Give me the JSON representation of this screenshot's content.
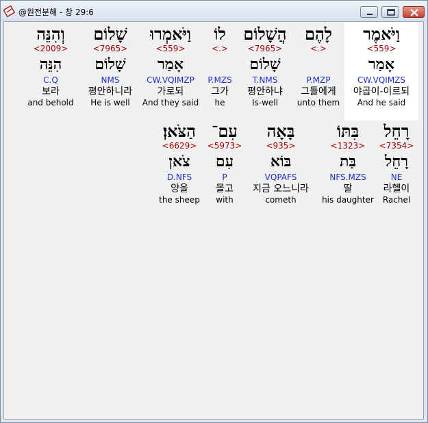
{
  "window": {
    "title": "@원전분해 - 창 29:6",
    "minimize_icon": "minimize-icon",
    "maximize_icon": "maximize-icon",
    "close_icon": "close-icon",
    "app_icon": "bible-app-icon"
  },
  "rows": [
    {
      "words": [
        {
          "hebrew": "וַיֹּאמֶר",
          "strong": "<559>",
          "root": "אָמַר",
          "parse": "CW.VQIMZS",
          "korean": "야곱이-이르되",
          "english": "And he said",
          "selected": true
        },
        {
          "hebrew": "לָהֶם",
          "strong": "<.>",
          "root": "",
          "parse": "P.MZP",
          "korean": "그들에게",
          "english": "unto them"
        },
        {
          "hebrew": "הֲשָׁלוֹם",
          "strong": "<7965>",
          "root": "שָׁלוֹם",
          "parse": "T.NMS",
          "korean": "평안하냐",
          "english": "Is-well"
        },
        {
          "hebrew": "לוֹ",
          "strong": "<.>",
          "root": "",
          "parse": "P.MZS",
          "korean": "그가",
          "english": "he"
        },
        {
          "hebrew": "וַיֹּאמְרוּ",
          "strong": "<559>",
          "root": "אָמַר",
          "parse": "CW.VQIMZP",
          "korean": "가로되",
          "english": "And they said"
        },
        {
          "hebrew": "שָׁלוֹם",
          "strong": "<7965>",
          "root": "שָׁלוֹם",
          "parse": "NMS",
          "korean": "평안하니라",
          "english": "He is well"
        },
        {
          "hebrew": "וְהִנֵּה",
          "strong": "<2009>",
          "root": "הִנֵּה",
          "parse": "C.Q",
          "korean": "보라",
          "english": "and behold"
        }
      ]
    },
    {
      "words": [
        {
          "hebrew": "רָחֵל",
          "strong": "<7354>",
          "root": "רָחֵל",
          "parse": "NE",
          "korean": "라헬이",
          "english": "Rachel"
        },
        {
          "hebrew": "בִּתּוֹ",
          "strong": "<1323>",
          "root": "בַּת",
          "parse": "NFS.MZS",
          "korean": "딸",
          "english": "his daughter"
        },
        {
          "hebrew": "בָּאָה",
          "strong": "<935>",
          "root": "בּוֹא",
          "parse": "VQPAFS",
          "korean": "지금 오느니라",
          "english": "cometh"
        },
        {
          "hebrew": "עִם־",
          "strong": "<5973>",
          "root": "עִם",
          "parse": "P",
          "korean": "몰고",
          "english": "with"
        },
        {
          "hebrew": "הַצֹּאן׃",
          "strong": "<6629>",
          "root": "צֹאן",
          "parse": "D.NFS",
          "korean": "양을",
          "english": "the sheep"
        }
      ]
    }
  ]
}
